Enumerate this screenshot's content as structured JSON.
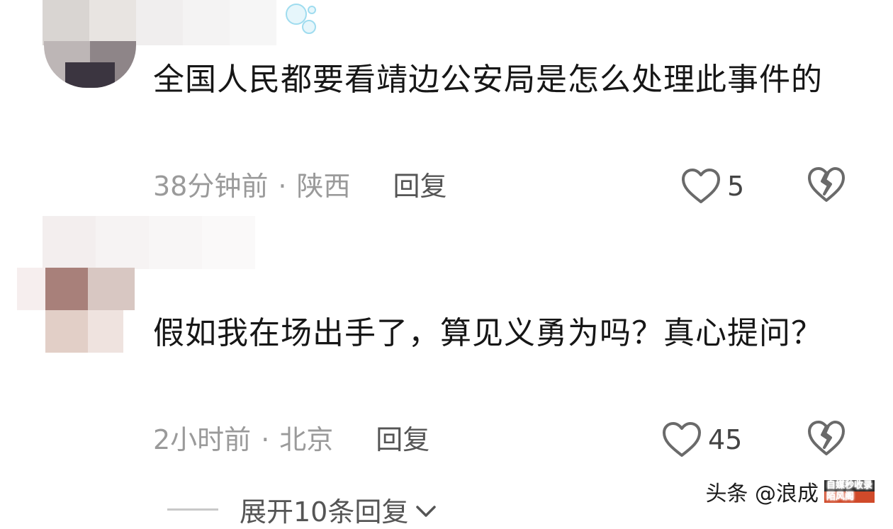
{
  "comments": [
    {
      "text": "全国人民都要看靖边公安局是怎么处理此事件的",
      "time": "38分钟前",
      "separator": "·",
      "location": "陕西",
      "reply_label": "回复",
      "likes": "5",
      "like_icon": "heart-outline-icon",
      "dislike_icon": "broken-heart-icon"
    },
    {
      "text": "假如我在场出手了，算见义勇为吗？真心提问？",
      "time": "2小时前",
      "separator": "·",
      "location": "北京",
      "reply_label": "回复",
      "likes": "45",
      "like_icon": "heart-outline-icon",
      "dislike_icon": "broken-heart-icon"
    }
  ],
  "expand_replies": {
    "label": "展开10条回复",
    "icon": "chevron-down-icon"
  },
  "watermark": {
    "text": "头条 @浪成",
    "badge_top": "自媒秒收录",
    "badge_bottom": "陌风阁"
  },
  "colors": {
    "text": "#161616",
    "meta": "#9a9a9a",
    "icon": "#6a6a6a",
    "background": "#ffffff"
  }
}
